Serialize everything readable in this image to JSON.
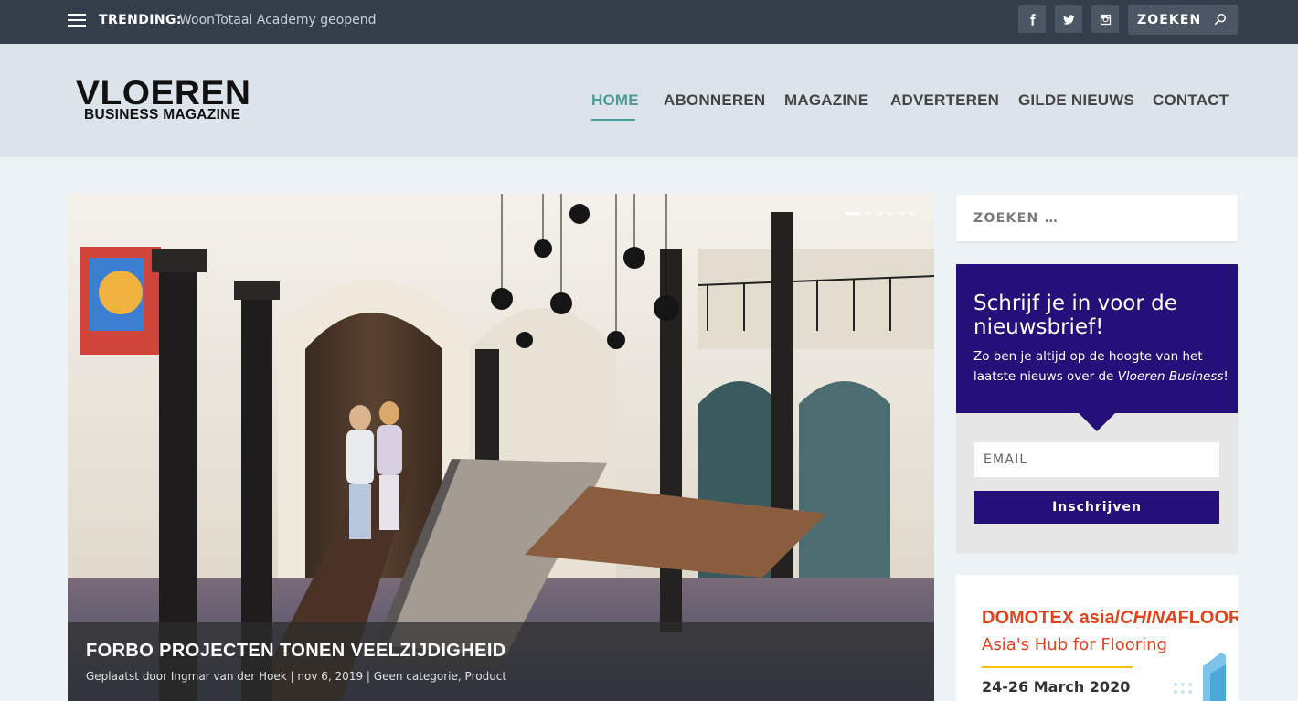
{
  "topbar": {
    "trending_label": "TRENDING:",
    "trending_text": "WoonTotaal Academy geopend",
    "search_label": "ZOEKEN",
    "social": [
      "facebook-icon",
      "twitter-icon",
      "instagram-icon"
    ]
  },
  "header": {
    "logo_line1": "VLOEREN",
    "logo_line2": "BUSINESS MAGAZINE",
    "nav": [
      "HOME",
      "ABONNEREN",
      "MAGAZINE",
      "ADVERTEREN",
      "GILDE NIEUWS",
      "CONTACT"
    ],
    "active_nav": "HOME",
    "accent_color": "#4c9b99"
  },
  "hero": {
    "title": "FORBO PROJECTEN TONEN VEELZIJDIGHEID",
    "meta_prefix": "Geplaatst door ",
    "author": "Ingmar van der Hoek",
    "separator": " | ",
    "date": "nov 6, 2019",
    "category1": "Geen categorie",
    "category_sep": ", ",
    "category2": "Product",
    "slides": 6,
    "active_slide": 1
  },
  "sidebar": {
    "search_placeholder": "ZOEKEN …",
    "newsletter": {
      "heading": "Schrijf je in voor de nieuwsbrief!",
      "text_before": "Zo ben je altijd op de hoogte van het laatste nieuws over de ",
      "text_em": "Vloeren Business",
      "text_after": "!",
      "email_placeholder": "EMAIL",
      "button": "Inschrijven",
      "color": "#250f78"
    },
    "ad": {
      "line1_a": "DOMOTEX asia/",
      "line1_b": "CHINA",
      "line1_c": "FLOOR",
      "line2": "Asia's Hub for Flooring",
      "line3": "24-26 March 2020"
    }
  }
}
